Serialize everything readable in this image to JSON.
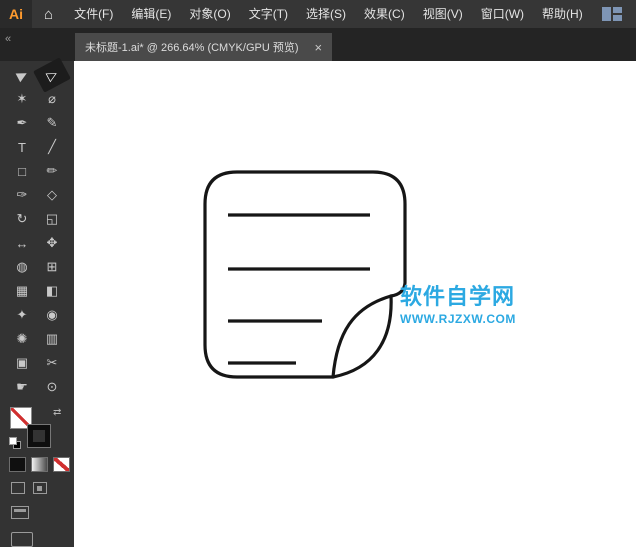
{
  "app": {
    "logo_text": "Ai"
  },
  "icons": {
    "home": "⌂",
    "swap": "⇄",
    "collapse": "«",
    "close": "×"
  },
  "menubar": {
    "items": [
      {
        "name": "menu-file",
        "label": "文件(F)"
      },
      {
        "name": "menu-edit",
        "label": "编辑(E)"
      },
      {
        "name": "menu-object",
        "label": "对象(O)"
      },
      {
        "name": "menu-type",
        "label": "文字(T)"
      },
      {
        "name": "menu-select",
        "label": "选择(S)"
      },
      {
        "name": "menu-effect",
        "label": "效果(C)"
      },
      {
        "name": "menu-view",
        "label": "视图(V)"
      },
      {
        "name": "menu-window",
        "label": "窗口(W)"
      },
      {
        "name": "menu-help",
        "label": "帮助(H)"
      }
    ]
  },
  "document_tab": {
    "title": "未标题-1.ai* @ 266.64% (CMYK/GPU 预览)",
    "zoom_level": "266.64%",
    "color_mode": "CMYK/GPU 预览",
    "close_label": "×"
  },
  "toolbar": {
    "collapse_icon": "«",
    "tools": [
      {
        "name": "selection-tool",
        "glyph": "▶",
        "cursor": true
      },
      {
        "name": "direct-selection-tool",
        "glyph": "▷",
        "cursor": true,
        "active": true
      },
      {
        "name": "magic-wand-tool",
        "glyph": "✶"
      },
      {
        "name": "lasso-tool",
        "glyph": "⌀"
      },
      {
        "name": "pen-tool",
        "glyph": "✒"
      },
      {
        "name": "curvature-tool",
        "glyph": "✎"
      },
      {
        "name": "type-tool",
        "glyph": "T"
      },
      {
        "name": "line-segment-tool",
        "glyph": "╱"
      },
      {
        "name": "rectangle-tool",
        "glyph": "□"
      },
      {
        "name": "pencil-tool",
        "glyph": "✏"
      },
      {
        "name": "paintbrush-tool",
        "glyph": "✑"
      },
      {
        "name": "shaper-tool",
        "glyph": "◇"
      },
      {
        "name": "rotate-tool",
        "glyph": "↻"
      },
      {
        "name": "scale-tool",
        "glyph": "◱"
      },
      {
        "name": "width-tool",
        "glyph": "↔"
      },
      {
        "name": "free-transform-tool",
        "glyph": "✥"
      },
      {
        "name": "shape-builder-tool",
        "glyph": "◍"
      },
      {
        "name": "perspective-grid-tool",
        "glyph": "⊞"
      },
      {
        "name": "mesh-tool",
        "glyph": "▦"
      },
      {
        "name": "gradient-tool",
        "glyph": "◧"
      },
      {
        "name": "eyedropper-tool",
        "glyph": "✦"
      },
      {
        "name": "blend-tool",
        "glyph": "◉"
      },
      {
        "name": "symbol-sprayer-tool",
        "glyph": "✺"
      },
      {
        "name": "column-graph-tool",
        "glyph": "▥"
      },
      {
        "name": "artboard-tool",
        "glyph": "▣"
      },
      {
        "name": "slice-tool",
        "glyph": "✂"
      },
      {
        "name": "hand-tool",
        "glyph": "☛"
      },
      {
        "name": "zoom-tool",
        "glyph": "⊙"
      }
    ],
    "fill": "none",
    "stroke": "black"
  },
  "canvas": {
    "artwork": "note-page-outline-with-folded-corner",
    "stroke_color": "#161616",
    "watermark": {
      "line1": "软件自学网",
      "line2": "WWW.RJZXW.COM",
      "color": "#2CA9E2"
    }
  }
}
